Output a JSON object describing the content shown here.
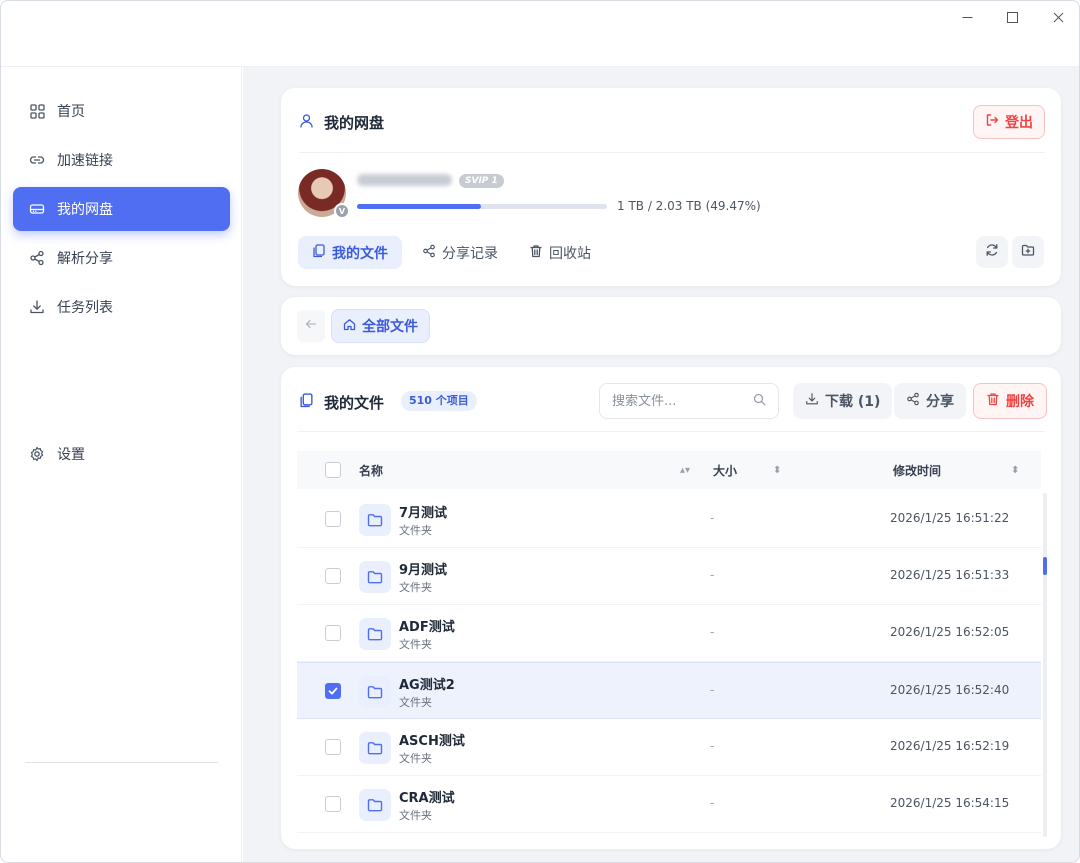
{
  "sidebar": {
    "items": [
      {
        "label": "首页",
        "icon": "grid-icon"
      },
      {
        "label": "加速链接",
        "icon": "link-icon"
      },
      {
        "label": "我的网盘",
        "icon": "drive-icon",
        "active": true
      },
      {
        "label": "解析分享",
        "icon": "share-icon"
      },
      {
        "label": "任务列表",
        "icon": "download-icon"
      }
    ],
    "settings_label": "设置"
  },
  "profile": {
    "title": "我的网盘",
    "logout_label": "登出",
    "vip_badge": "SVIP 1",
    "avatar_badge": "V",
    "quota_text": "1 TB / 2.03 TB (49.47%)",
    "quota_fraction": 0.4947,
    "tabs": [
      {
        "label": "我的文件",
        "active": true
      },
      {
        "label": "分享记录"
      },
      {
        "label": "回收站"
      }
    ]
  },
  "breadcrumb": {
    "root_label": "全部文件"
  },
  "files": {
    "title": "我的文件",
    "count_badge": "510 个项目",
    "search_placeholder": "搜索文件...",
    "download_label": "下载 (1)",
    "share_label": "分享",
    "delete_label": "删除",
    "columns": {
      "name": "名称",
      "size": "大小",
      "modified": "修改时间"
    },
    "rows": [
      {
        "name": "7月测试",
        "type": "文件夹",
        "size": "-",
        "modified": "2026/1/25 16:51:22",
        "selected": false
      },
      {
        "name": "9月测试",
        "type": "文件夹",
        "size": "-",
        "modified": "2026/1/25 16:51:33",
        "selected": false
      },
      {
        "name": "ADF测试",
        "type": "文件夹",
        "size": "-",
        "modified": "2026/1/25 16:52:05",
        "selected": false
      },
      {
        "name": "AG测试2",
        "type": "文件夹",
        "size": "-",
        "modified": "2026/1/25 16:52:40",
        "selected": true
      },
      {
        "name": "ASCH测试",
        "type": "文件夹",
        "size": "-",
        "modified": "2026/1/25 16:52:19",
        "selected": false
      },
      {
        "name": "CRA测试",
        "type": "文件夹",
        "size": "-",
        "modified": "2026/1/25 16:54:15",
        "selected": false
      }
    ]
  },
  "colors": {
    "accent": "#4f6ef2",
    "danger": "#ef4444",
    "background": "#f1f3f7"
  }
}
